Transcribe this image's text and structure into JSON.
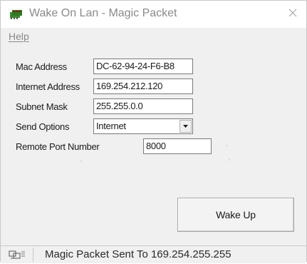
{
  "window": {
    "title": "Wake On Lan - Magic Packet",
    "icon": "network-cards-icon",
    "close_icon": "close-icon"
  },
  "menu": {
    "items": [
      {
        "label": "Help"
      }
    ]
  },
  "form": {
    "mac_address": {
      "label": "Mac Address",
      "value": "DC-62-94-24-F6-B8"
    },
    "internet_address": {
      "label": "Internet Address",
      "value": "169.254.212.120"
    },
    "subnet_mask": {
      "label": "Subnet Mask",
      "value": "255.255.0.0"
    },
    "send_options": {
      "label": "Send Options",
      "value": "Internet"
    },
    "remote_port": {
      "label": "Remote Port Number",
      "value": "8000"
    }
  },
  "actions": {
    "wake_up_label": "Wake Up"
  },
  "status": {
    "icon": "network-status-icon",
    "text": "Magic Packet Sent To 169.254.255.255"
  },
  "colors": {
    "window_bg": "#f0f0f0",
    "titlebar_bg": "#ffffff",
    "title_text": "#8a8a8a",
    "icon_green": "#3a8a2a"
  }
}
